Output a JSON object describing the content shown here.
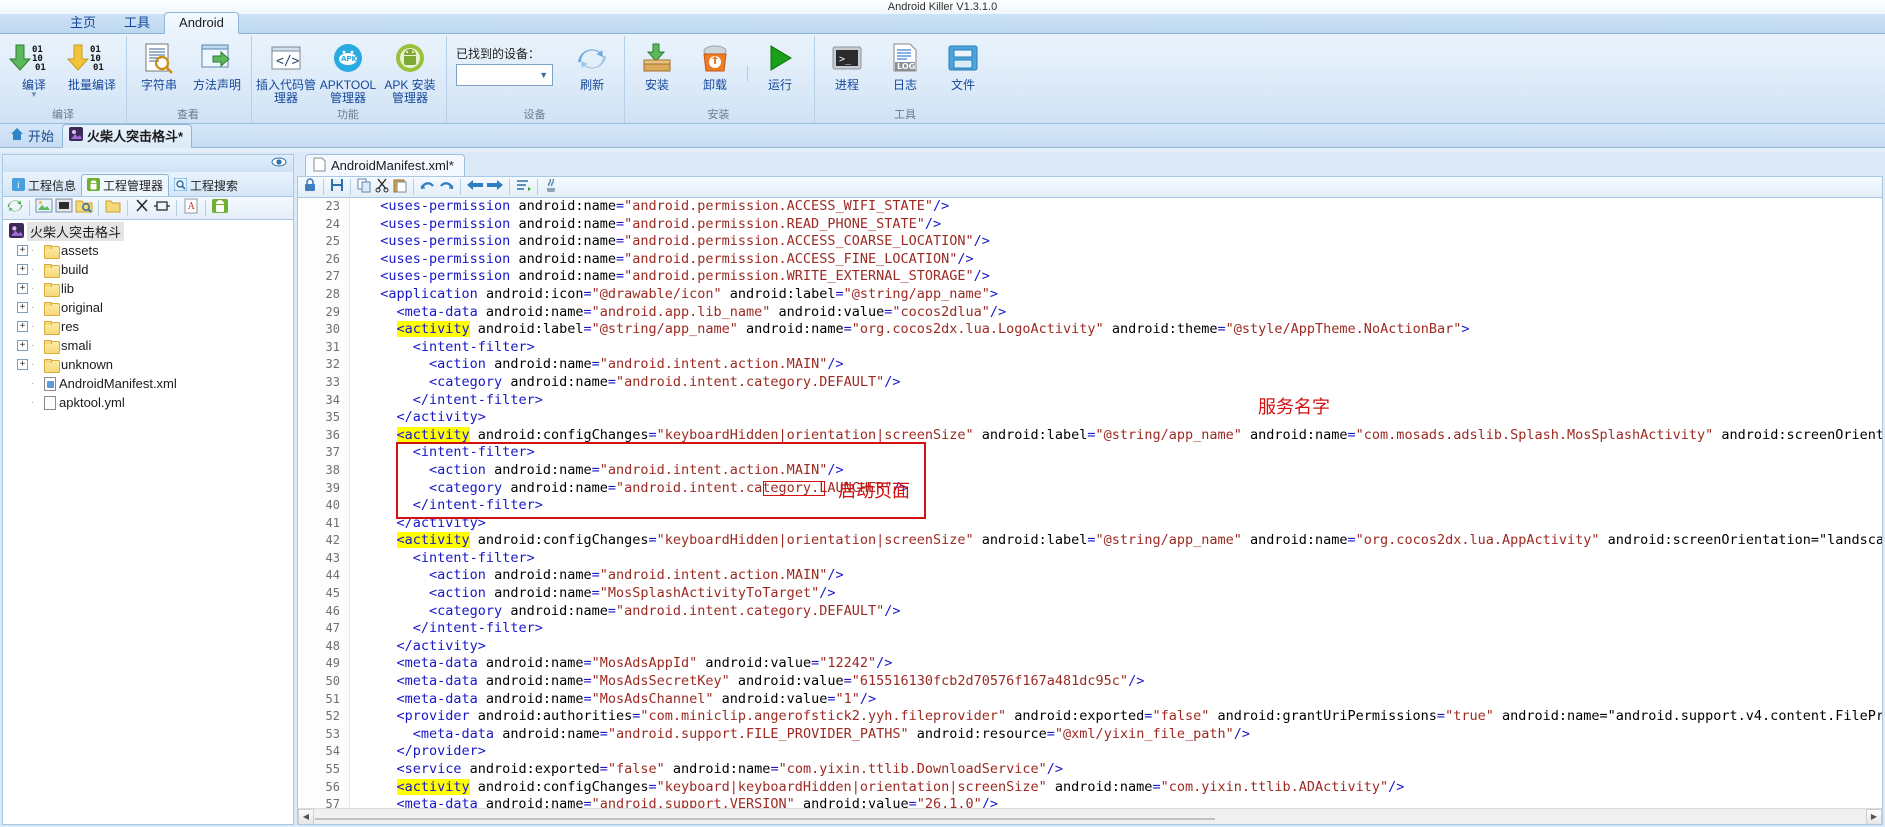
{
  "window": {
    "title": "Android Killer V1.3.1.0"
  },
  "ribbon": {
    "tabs": [
      {
        "label": "主页",
        "active": false
      },
      {
        "label": "工具",
        "active": false
      },
      {
        "label": "Android",
        "active": true
      }
    ],
    "groups": [
      {
        "title": "编译",
        "buttons": [
          {
            "label": "编译",
            "icon": "compile-icon",
            "has_dropdown": true
          },
          {
            "label": "批量编译",
            "icon": "batch-compile-icon",
            "has_dropdown": false
          }
        ]
      },
      {
        "title": "查看",
        "buttons": [
          {
            "label": "字符串",
            "icon": "string-search-icon",
            "has_dropdown": false
          },
          {
            "label": "方法声明",
            "icon": "method-declaration-icon",
            "has_dropdown": false
          }
        ]
      },
      {
        "title": "功能",
        "buttons": [
          {
            "label": "插入代码管理器",
            "icon": "insert-code-icon",
            "has_dropdown": false
          },
          {
            "label": "APKTOOL 管理器",
            "icon": "apktool-icon",
            "has_dropdown": false
          },
          {
            "label": "APK 安装管理器",
            "icon": "apk-install-icon",
            "has_dropdown": false
          }
        ]
      },
      {
        "title": "设备",
        "device_label": "已找到的设备：",
        "device_value": "",
        "buttons": [
          {
            "label": "刷新",
            "icon": "refresh-icon",
            "has_dropdown": false
          }
        ]
      },
      {
        "title": "安装",
        "buttons": [
          {
            "label": "安装",
            "icon": "install-icon",
            "has_dropdown": false
          },
          {
            "label": "卸载",
            "icon": "uninstall-icon",
            "has_dropdown": false
          },
          {
            "label": "运行",
            "icon": "run-icon",
            "has_dropdown": false
          }
        ]
      },
      {
        "title": "工具",
        "buttons": [
          {
            "label": "进程",
            "icon": "process-icon",
            "has_dropdown": false
          },
          {
            "label": "日志",
            "icon": "log-icon",
            "has_dropdown": false
          },
          {
            "label": "文件",
            "icon": "file-manager-icon",
            "has_dropdown": false
          }
        ]
      }
    ]
  },
  "doctabs": [
    {
      "label": "开始",
      "icon": "home-icon",
      "active": false
    },
    {
      "label": "火柴人突击格斗*",
      "icon": "project-icon",
      "active": true
    }
  ],
  "left_panel": {
    "eye_icon": "eye-icon",
    "tabs": [
      {
        "label": "工程信息",
        "icon": "info-icon",
        "active": false
      },
      {
        "label": "工程管理器",
        "icon": "android-icon",
        "active": true
      },
      {
        "label": "工程搜索",
        "icon": "search-icon",
        "active": false
      }
    ],
    "toolbar_icons": [
      "refresh-icon",
      "image-icon",
      "black-square-icon",
      "folder-search-icon",
      "folder-icon",
      "cut-icon",
      "rename-icon",
      "text-file-icon",
      "android-build-icon"
    ],
    "tree": {
      "root": {
        "label": "火柴人突击格斗",
        "icon": "project-icon"
      },
      "children": [
        {
          "label": "assets",
          "type": "folder"
        },
        {
          "label": "build",
          "type": "folder"
        },
        {
          "label": "lib",
          "type": "folder"
        },
        {
          "label": "original",
          "type": "folder"
        },
        {
          "label": "res",
          "type": "folder"
        },
        {
          "label": "smali",
          "type": "folder"
        },
        {
          "label": "unknown",
          "type": "folder"
        },
        {
          "label": "AndroidManifest.xml",
          "type": "xml"
        },
        {
          "label": "apktool.yml",
          "type": "file"
        }
      ]
    }
  },
  "editor": {
    "tab": {
      "label": "AndroidManifest.xml*",
      "icon": "file-icon"
    },
    "toolbar_icons": [
      "lock-icon",
      "save-icon",
      "copy-icon",
      "cut-icon",
      "paste-icon",
      "undo-icon",
      "redo-icon",
      "back-icon",
      "forward-icon",
      "format-icon",
      "java-icon"
    ],
    "first_line_number": 23,
    "lines": [
      {
        "n": 23,
        "indent": 2,
        "text": "<uses-permission android:name=\"android.permission.ACCESS_WIFI_STATE\"/>"
      },
      {
        "n": 24,
        "indent": 2,
        "text": "<uses-permission android:name=\"android.permission.READ_PHONE_STATE\"/>"
      },
      {
        "n": 25,
        "indent": 2,
        "text": "<uses-permission android:name=\"android.permission.ACCESS_COARSE_LOCATION\"/>"
      },
      {
        "n": 26,
        "indent": 2,
        "text": "<uses-permission android:name=\"android.permission.ACCESS_FINE_LOCATION\"/>"
      },
      {
        "n": 27,
        "indent": 2,
        "text": "<uses-permission android:name=\"android.permission.WRITE_EXTERNAL_STORAGE\"/>"
      },
      {
        "n": 28,
        "indent": 2,
        "text": "<application android:icon=\"@drawable/icon\" android:label=\"@string/app_name\">"
      },
      {
        "n": 29,
        "indent": 4,
        "text": "<meta-data android:name=\"android.app.lib_name\" android:value=\"cocos2dlua\"/>"
      },
      {
        "n": 30,
        "indent": 4,
        "text": "<activity android:label=\"@string/app_name\" android:name=\"org.cocos2dx.lua.LogoActivity\" android:theme=\"@style/AppTheme.NoActionBar\">",
        "highlight_tag": "activity"
      },
      {
        "n": 31,
        "indent": 6,
        "text": "<intent-filter>"
      },
      {
        "n": 32,
        "indent": 8,
        "text": "<action android:name=\"android.intent.action.MAIN\"/>"
      },
      {
        "n": 33,
        "indent": 8,
        "text": "<category android:name=\"android.intent.category.DEFAULT\"/>"
      },
      {
        "n": 34,
        "indent": 6,
        "text": "</intent-filter>"
      },
      {
        "n": 35,
        "indent": 4,
        "text": "</activity>"
      },
      {
        "n": 36,
        "indent": 4,
        "text": "<activity android:configChanges=\"keyboardHidden|orientation|screenSize\" android:label=\"@string/app_name\" android:name=\"com.mosads.adslib.Splash.MosSplashActivity\" android:screenOrient",
        "highlight_tag": "activity"
      },
      {
        "n": 37,
        "indent": 6,
        "text": "<intent-filter>"
      },
      {
        "n": 38,
        "indent": 8,
        "text": "<action android:name=\"android.intent.action.MAIN\"/>"
      },
      {
        "n": 39,
        "indent": 8,
        "text": "<category android:name=\"android.intent.category.LAUNCHER\"/>"
      },
      {
        "n": 40,
        "indent": 6,
        "text": "</intent-filter>"
      },
      {
        "n": 41,
        "indent": 4,
        "text": "</activity>"
      },
      {
        "n": 42,
        "indent": 4,
        "text": "<activity android:configChanges=\"keyboardHidden|orientation|screenSize\" android:label=\"@string/app_name\" android:name=\"org.cocos2dx.lua.AppActivity\" android:screenOrientation=\"landsca",
        "highlight_tag": "activity"
      },
      {
        "n": 43,
        "indent": 6,
        "text": "<intent-filter>"
      },
      {
        "n": 44,
        "indent": 8,
        "text": "<action android:name=\"android.intent.action.MAIN\"/>"
      },
      {
        "n": 45,
        "indent": 8,
        "text": "<action android:name=\"MosSplashActivityToTarget\"/>"
      },
      {
        "n": 46,
        "indent": 8,
        "text": "<category android:name=\"android.intent.category.DEFAULT\"/>"
      },
      {
        "n": 47,
        "indent": 6,
        "text": "</intent-filter>"
      },
      {
        "n": 48,
        "indent": 4,
        "text": "</activity>"
      },
      {
        "n": 49,
        "indent": 4,
        "text": "<meta-data android:name=\"MosAdsAppId\" android:value=\"12242\"/>"
      },
      {
        "n": 50,
        "indent": 4,
        "text": "<meta-data android:name=\"MosAdsSecretKey\" android:value=\"615516130fcb2d70576f167a481dc95c\"/>"
      },
      {
        "n": 51,
        "indent": 4,
        "text": "<meta-data android:name=\"MosAdsChannel\" android:value=\"1\"/>"
      },
      {
        "n": 52,
        "indent": 4,
        "text": "<provider android:authorities=\"com.miniclip.angerofstick2.yyh.fileprovider\" android:exported=\"false\" android:grantUriPermissions=\"true\" android:name=\"android.support.v4.content.FilePr"
      },
      {
        "n": 53,
        "indent": 6,
        "text": "<meta-data android:name=\"android.support.FILE_PROVIDER_PATHS\" android:resource=\"@xml/yixin_file_path\"/>"
      },
      {
        "n": 54,
        "indent": 4,
        "text": "</provider>"
      },
      {
        "n": 55,
        "indent": 4,
        "text": "<service android:exported=\"false\" android:name=\"com.yixin.ttlib.DownloadService\"/>"
      },
      {
        "n": 56,
        "indent": 4,
        "text": "<activity android:configChanges=\"keyboard|keyboardHidden|orientation|screenSize\" android:name=\"com.yixin.ttlib.ADActivity\"/>",
        "highlight_tag": "activity"
      },
      {
        "n": 57,
        "indent": 4,
        "text": "<meta-data android:name=\"android.support.VERSION\" android:value=\"26.1.0\"/>"
      }
    ]
  },
  "annotations": [
    {
      "id": "service-name",
      "text": "服务名字",
      "color": "#d31111"
    },
    {
      "id": "launcher-page",
      "text": "启动页面",
      "color": "#d31111"
    }
  ],
  "colors": {
    "accent": "#15489c",
    "annotation_red": "#d31111",
    "highlight_yellow": "#ffff00",
    "tag_blue": "#1717c9",
    "string_red": "#9c2a22"
  }
}
